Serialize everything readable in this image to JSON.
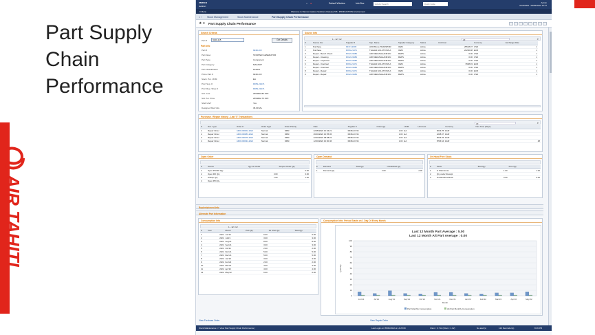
{
  "slide": {
    "title_lines": [
      "Part Supply",
      "Chain",
      "Performance"
    ],
    "brand_text": "AIR TAHITI"
  },
  "app": {
    "logo": [
      "ramco",
      "aviation"
    ],
    "topbar": {
      "default_window": "Default Window",
      "info_box": "Info Box",
      "activity_search": "Activity Search",
      "quick_code": "Quick Code",
      "user_line1": "Admin",
      "user_line2": "AUADMIN - 09/05/2021 10:47"
    },
    "nav": {
      "menu": "≡ Menu",
      "welcome": "Welcome to Ramco Aviation Solutions Release 5.8 : PRODUCTION Environment"
    },
    "breadcrumb": [
      "Stock Management",
      "Stock Maintenance",
      "Part Supply Chain Performance"
    ],
    "page_title": "Part Supply Chain Performance",
    "search_criteria": {
      "header": "Search Criteria",
      "part_label": "Part #",
      "part_value": "9240-115",
      "button": "Get Details"
    },
    "part_info": {
      "header": "Part Info",
      "fields": [
        {
          "k": "Part #",
          "v": "9240-115"
        },
        {
          "k": "Part Desc.",
          "v": "STARTER GENERATOR"
        },
        {
          "k": "Part Type",
          "v": "Component"
        },
        {
          "k": "Part Category",
          "v": "MAGSOT"
        },
        {
          "k": "Part Classification",
          "v": "Rotable"
        },
        {
          "k": "Prime Part #",
          "v": "9240-115"
        },
        {
          "k": "Stock. Pur. UOM",
          "v": "EA"
        },
        {
          "k": "Pref. Sup. #",
          "v": "R051-21471"
        },
        {
          "k": "Pref. Rep. Shop #",
          "v": "R051-21471"
        },
        {
          "k": "Std. Cost",
          "v": "2654662.80 XPF"
        },
        {
          "k": "Std. Pur. Price",
          "v": "2654662.75 XPF"
        },
        {
          "k": "Shelf Life?",
          "v": "Yes"
        },
        {
          "k": "Designed Shelf Life",
          "v": "36.00 Mo."
        }
      ]
    },
    "source_info": {
      "header": "Source Info",
      "pager": "1 - 12 / 12",
      "filter": "All",
      "columns": [
        "#",
        "Source For",
        "Supplier #",
        "Sup. Name",
        "Supplier Category",
        "Status",
        "Unit Cost",
        "Currency",
        "Exchange Rate"
      ],
      "rows": [
        [
          "1",
          "Purchase",
          "9017-11609",
          "AVIONS de TRANSPOR",
          "OEM",
          "Active",
          "29518.07",
          "USD",
          "1"
        ],
        [
          "2",
          "Purchase",
          "R051-21471",
          "THALES SOLUTIONS A",
          "OEM",
          "Active",
          "22260.98",
          "EUR",
          "1"
        ],
        [
          "3",
          "Repair - Bench Check",
          "R012-31984",
          "AIR NEW ZEALAND EN",
          "REPS",
          "Active",
          "0.00",
          "USD",
          "1"
        ],
        [
          "4",
          "Repair - Cleaning",
          "R012-31984",
          "AIR NEW ZEALAND EN",
          "REPS",
          "Active",
          "0.00",
          "USD",
          "1"
        ],
        [
          "5",
          "Repair - Inspection",
          "R012-31984",
          "AIR NEW ZEALAND EN",
          "REPS",
          "Active",
          "0.00",
          "USD",
          "1"
        ],
        [
          "6",
          "Repair - Overhaul",
          "R051-21471",
          "THALES SOLUTIONS A",
          "OEM",
          "Active",
          "3568.93",
          "EUR",
          "1"
        ],
        [
          "7",
          "Repair - Overhaul",
          "R012-31984",
          "AIR NEW ZEALAND EN",
          "REPS",
          "Active",
          "0.00",
          "USD",
          "1"
        ],
        [
          "8",
          "Repair - Repair",
          "R051-21471",
          "THALES SOLUTIONS A",
          "OEM",
          "Active",
          "0.00",
          "EUR",
          "1"
        ],
        [
          "9",
          "Repair - Repair",
          "R012-31984",
          "AIR NEW ZEALAND EN",
          "REPS",
          "Active",
          "0.00",
          "USD",
          "1"
        ]
      ]
    },
    "purchase_history": {
      "header": "Purchase / Repair history - Last '5' Transactions",
      "filter": "All",
      "columns": [
        "#",
        "Doc. Type",
        "Order #",
        "Order Type",
        "Order Priority",
        "Date",
        "Supplier #",
        "Order Qty",
        "UOM",
        "Unit Cost",
        "Currency",
        "Turn Time (Days)"
      ],
      "rows": [
        [
          "1",
          "Repair Order",
          "ARO-000402-2021",
          "Normal",
          "NRM",
          "22/05/2022 10:04:21",
          "R048-21734",
          "1.00",
          "EA",
          "6023.25",
          "EUR",
          ""
        ],
        [
          "2",
          "Repair Order",
          "ARO-000383-2021",
          "Normal",
          "NRM",
          "26/04/2022 10:55:36",
          "R048-21734",
          "1.00",
          "EA",
          "4238.97",
          "EUR",
          ""
        ],
        [
          "3",
          "Repair Order",
          "ARO-000376-2021",
          "Normal",
          "NRM",
          "22/04/2022 08:58:22",
          "R048-21734",
          "1.00",
          "EA",
          "6023.25",
          "EUR",
          ""
        ],
        [
          "4",
          "Repair Order",
          "ARO-000334-2021",
          "Normal",
          "NRM",
          "12/04/2022 10:00:46",
          "R048-21734",
          "1.00",
          "EA",
          "8736.64",
          "EUR",
          "48"
        ]
      ]
    },
    "open_order": {
      "header": "Open Order",
      "columns": [
        "#",
        "Source",
        "Qty On Order",
        "Surplus Order Qty"
      ],
      "rows": [
        [
          "1",
          "Open PO/RO Qty.",
          "",
          "0.00"
        ],
        [
          "2",
          "Open RO Qty.",
          "3.00",
          "3.00"
        ],
        [
          "3",
          "InShop Qty.",
          "1.00",
          "1.00"
        ],
        [
          "4",
          "Open PR Qty.",
          "",
          ""
        ]
      ]
    },
    "open_demand": {
      "header": "Open Demand",
      "columns": [
        "#",
        "Demand",
        "Total Qty",
        "Unsatisfied Qty"
      ],
      "rows": [
        [
          "1",
          "Demand Qty.",
          "2.00",
          "2.00"
        ]
      ]
    },
    "on_hand": {
      "header": "On Hand Free Stock",
      "columns": [
        "#",
        "Stock",
        "Total Qty",
        "Free Qty"
      ],
      "rows": [
        [
          "1",
          "In Warehouse",
          "1.00",
          "1.00"
        ],
        [
          "2",
          "Qty under Receipt",
          "",
          ""
        ],
        [
          "3",
          "OnHandFreeStock",
          "0.00",
          "0.00"
        ]
      ]
    },
    "collapsed": [
      "Replenishment Info",
      "Alternate Part Information"
    ],
    "consumption_info": {
      "header": "Consumption Info",
      "pager": "1 - 12 / 12",
      "columns": [
        "#",
        "Year",
        "Month",
        "Part Qty.",
        "Alt. Part Qty.",
        "Total Qty."
      ],
      "rows": [
        [
          "1",
          "2021",
          "Jun'21",
          "6.00",
          "",
          "6.00"
        ],
        [
          "2",
          "2021",
          "Jul'21",
          "3.00",
          "",
          "3.00"
        ],
        [
          "3",
          "2021",
          "Aug'21",
          "8.00",
          "",
          "8.00"
        ],
        [
          "4",
          "2021",
          "Sep'21",
          "3.00",
          "",
          "3.00"
        ],
        [
          "5",
          "2021",
          "Oct'21",
          "2.00",
          "",
          "2.00"
        ],
        [
          "6",
          "2021",
          "Nov'21",
          "5.00",
          "",
          "5.00"
        ],
        [
          "7",
          "2021",
          "Dec'21",
          "5.00",
          "",
          "5.00"
        ],
        [
          "8",
          "2022",
          "Jan'22",
          "3.00",
          "",
          "3.00"
        ],
        [
          "9",
          "2022",
          "Feb'22",
          "2.00",
          "",
          "2.00"
        ],
        [
          "10",
          "2022",
          "Mar'22",
          "4.00",
          "",
          "4.00"
        ],
        [
          "11",
          "2022",
          "Apr'22",
          "4.00",
          "",
          "4.00"
        ],
        [
          "12",
          "2022",
          "May'22",
          "6.00",
          "",
          "6.00"
        ]
      ]
    },
    "chart_panel_header": "Consumption Info: Period Starts on 1 Day Of Every Month",
    "links": {
      "purchase_order": "View Purchase Order",
      "repair_order": "View Repair Order"
    },
    "footer": {
      "left": "Stock Maintenance >> View Part Supply Chain Performance |",
      "last_login": "Last Login on 05/06/2022 at 14:25:09",
      "server": "Client : 6.712 (Client : 1.02)",
      "alerts": "No alert(s)",
      "reminders": "124 Reminder(s)",
      "time": "8:46 PM"
    }
  },
  "chart_data": {
    "type": "bar",
    "title": "Last 12 Month Part Average : 5.00",
    "subtitle": "Last 12 Month Alt Part Average : 0.00",
    "xlabel": "Month",
    "ylabel": "Quantity",
    "ylim": [
      0,
      100
    ],
    "yticks": [
      0,
      10,
      20,
      30,
      40,
      50,
      60,
      70,
      80,
      90,
      100
    ],
    "categories": [
      "Jun'21",
      "Jul'21",
      "Aug'21",
      "Sep'21",
      "Oct'21",
      "Nov'21",
      "Dec'21",
      "Jan'22",
      "Feb'22",
      "Mar'22",
      "Apr'22",
      "May'22"
    ],
    "series": [
      {
        "name": "Part Monthly Consumption",
        "values": [
          6,
          3,
          8,
          3,
          2,
          5,
          5,
          3,
          2,
          4,
          4,
          6
        ],
        "color": "#6f97c9"
      },
      {
        "name": "Alt.Part Monthly Consumption",
        "values": [
          0,
          0,
          0,
          0,
          0,
          0,
          0,
          0,
          0,
          0,
          0,
          0
        ],
        "color": "#9dc38f"
      }
    ],
    "grid": true,
    "legend": "bottom"
  }
}
